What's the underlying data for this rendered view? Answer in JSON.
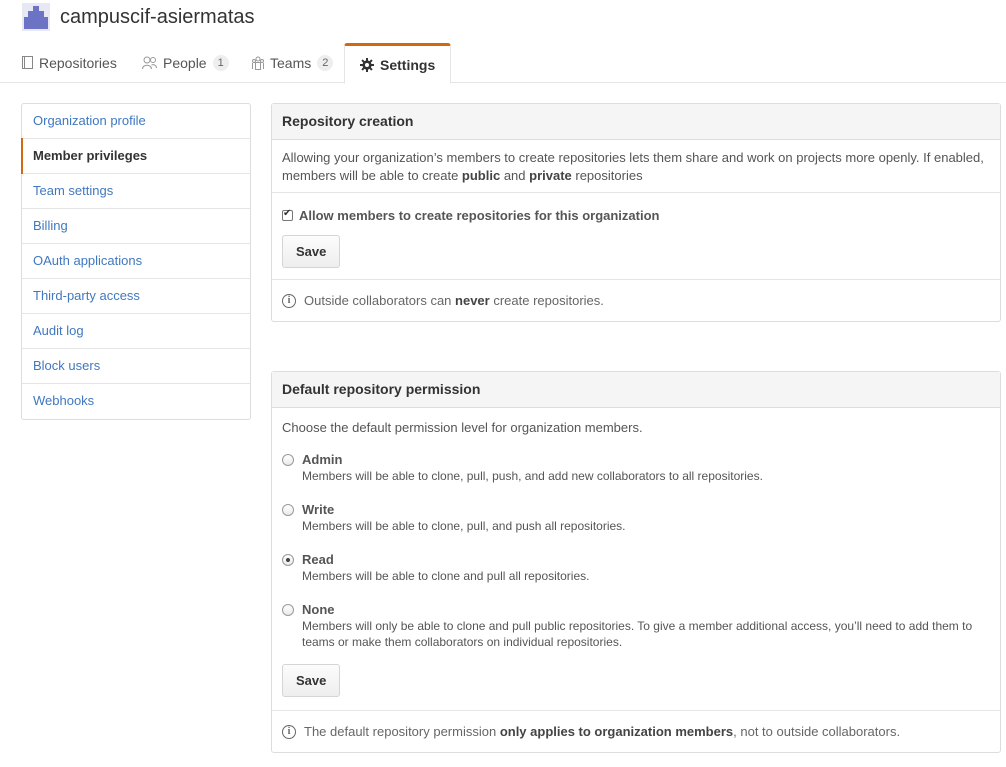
{
  "org": {
    "name": "campuscif-asiermatas"
  },
  "tabs": [
    {
      "label": "Repositories",
      "icon": "repo-icon"
    },
    {
      "label": "People",
      "icon": "people-icon",
      "count": "1"
    },
    {
      "label": "Teams",
      "icon": "teams-icon",
      "count": "2"
    },
    {
      "label": "Settings",
      "icon": "gear-icon",
      "selected": true
    }
  ],
  "sidebar": {
    "items": [
      {
        "label": "Organization profile"
      },
      {
        "label": "Member privileges",
        "selected": true
      },
      {
        "label": "Team settings"
      },
      {
        "label": "Billing"
      },
      {
        "label": "OAuth applications"
      },
      {
        "label": "Third-party access"
      },
      {
        "label": "Audit log"
      },
      {
        "label": "Block users"
      },
      {
        "label": "Webhooks"
      }
    ]
  },
  "repo_creation": {
    "title": "Repository creation",
    "desc_part1": "Allowing your organization’s members to create repositories lets them share and work on projects more openly. If enabled, members will be able to create ",
    "desc_public": "public",
    "desc_and": " and ",
    "desc_private": "private",
    "desc_part2": " repositories",
    "checkbox_label": "Allow members to create repositories for this organization",
    "checkbox_checked": true,
    "save_label": "Save",
    "note_part1": "Outside collaborators can ",
    "note_never": "never",
    "note_part2": " create repositories."
  },
  "default_permission": {
    "title": "Default repository permission",
    "intro": "Choose the default permission level for organization members.",
    "options": [
      {
        "title": "Admin",
        "desc": "Members will be able to clone, pull, push, and add new collaborators to all repositories.",
        "checked": false
      },
      {
        "title": "Write",
        "desc": "Members will be able to clone, pull, and push all repositories.",
        "checked": false
      },
      {
        "title": "Read",
        "desc": "Members will be able to clone and pull all repositories.",
        "checked": true
      },
      {
        "title": "None",
        "desc": "Members will only be able to clone and pull public repositories. To give a member additional access, you’ll need to add them to teams or make them collaborators on individual repositories.",
        "checked": false
      }
    ],
    "save_label": "Save",
    "note_part1": "The default repository permission ",
    "note_bold": "only applies to organization members",
    "note_part2": ", not to outside collaborators."
  },
  "colors": {
    "accent": "#d26911",
    "link": "#4078c0"
  }
}
